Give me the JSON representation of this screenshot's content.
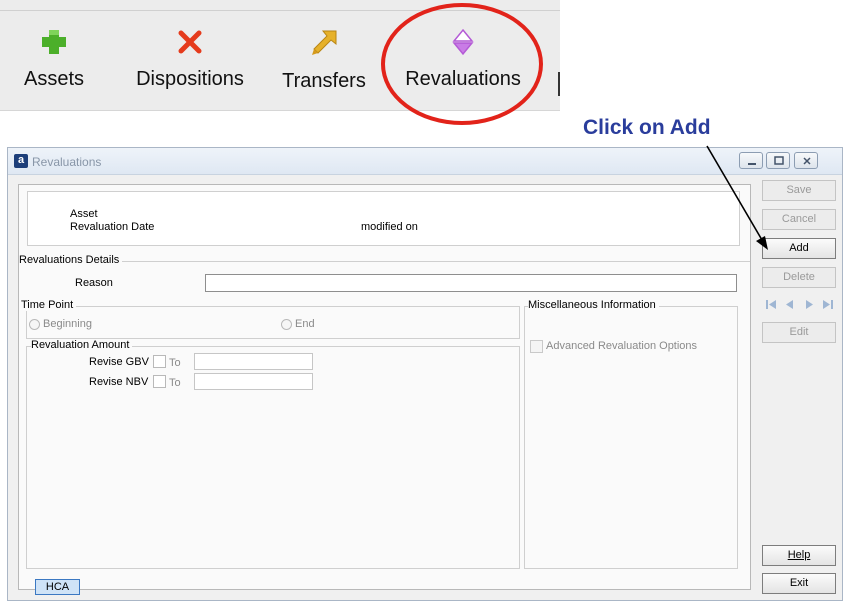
{
  "toolbar": {
    "items": [
      {
        "label": "Assets",
        "icon": "plus-icon"
      },
      {
        "label": "Dispositions",
        "icon": "x-icon"
      },
      {
        "label": "Transfers",
        "icon": "transfer-arrow-icon"
      },
      {
        "label": "Revaluations",
        "icon": "up-down-triangle-icon"
      }
    ]
  },
  "annotation": {
    "callout": "Click on Add",
    "highlight_color": "#e2231a",
    "callout_color": "#2a3d9c"
  },
  "window": {
    "title": "Revaluations",
    "app_icon": "a"
  },
  "header": {
    "asset_label": "Asset",
    "revaluation_date_label": "Revaluation Date",
    "modified_on_label": "modified on"
  },
  "details": {
    "group_title": "Revaluations Details",
    "reason_label": "Reason",
    "reason_value": ""
  },
  "time_point": {
    "group_title": "Time Point",
    "option_beginning": "Beginning",
    "option_end": "End"
  },
  "revaluation_amount": {
    "group_title": "Revaluation Amount",
    "revise_gbv_label": "Revise GBV",
    "revise_nbv_label": "Revise NBV",
    "to_label": "To",
    "gbv_value": "",
    "nbv_value": ""
  },
  "misc": {
    "group_title": "Miscellaneous Information",
    "advanced_option_label": "Advanced Revaluation Options"
  },
  "tabs": {
    "hca": "HCA"
  },
  "buttons": {
    "save": "Save",
    "cancel": "Cancel",
    "add": "Add",
    "delete": "Delete",
    "edit": "Edit",
    "help": "Help",
    "exit": "Exit"
  },
  "colors": {
    "plus_icon": "#4caf2a",
    "x_icon": "#e53b1c",
    "revaluation_icon": "#b45ad6"
  }
}
